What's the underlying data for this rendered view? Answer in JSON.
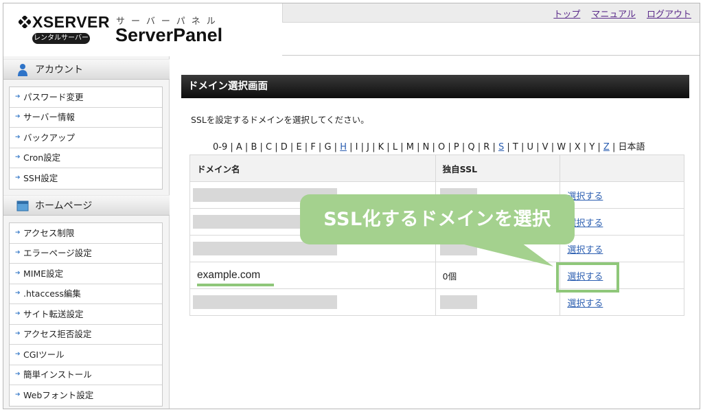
{
  "header": {
    "logo_text": "XSERVER",
    "logo_sub": "レンタルサーバー",
    "panel_kana": "サーバーパネル",
    "panel_title": "ServerPanel",
    "links": [
      "トップ",
      "マニュアル",
      "ログアウト"
    ]
  },
  "sidebar": {
    "account": {
      "title": "アカウント",
      "items": [
        "パスワード変更",
        "サーバー情報",
        "バックアップ",
        "Cron設定",
        "SSH設定"
      ]
    },
    "homepage": {
      "title": "ホームページ",
      "items": [
        "アクセス制限",
        "エラーページ設定",
        "MIME設定",
        ".htaccess編集",
        "サイト転送設定",
        "アクセス拒否設定",
        "CGIツール",
        "簡単インストール",
        "Webフォント設定"
      ]
    }
  },
  "main": {
    "title": "ドメイン選択画面",
    "instruction": "SSLを設定するドメインを選択してください。",
    "alpha_nav": [
      {
        "label": "0-9",
        "link": false
      },
      {
        "label": "A",
        "link": false
      },
      {
        "label": "B",
        "link": false
      },
      {
        "label": "C",
        "link": false
      },
      {
        "label": "D",
        "link": false
      },
      {
        "label": "E",
        "link": false
      },
      {
        "label": "F",
        "link": false
      },
      {
        "label": "G",
        "link": false
      },
      {
        "label": "H",
        "link": true
      },
      {
        "label": "I",
        "link": false
      },
      {
        "label": "J",
        "link": false
      },
      {
        "label": "K",
        "link": false
      },
      {
        "label": "L",
        "link": false
      },
      {
        "label": "M",
        "link": false
      },
      {
        "label": "N",
        "link": false
      },
      {
        "label": "O",
        "link": false
      },
      {
        "label": "P",
        "link": false
      },
      {
        "label": "Q",
        "link": false
      },
      {
        "label": "R",
        "link": false
      },
      {
        "label": "S",
        "link": true
      },
      {
        "label": "T",
        "link": false
      },
      {
        "label": "U",
        "link": false
      },
      {
        "label": "V",
        "link": false
      },
      {
        "label": "W",
        "link": false
      },
      {
        "label": "X",
        "link": false
      },
      {
        "label": "Y",
        "link": false
      },
      {
        "label": "Z",
        "link": true
      },
      {
        "label": "日本語",
        "link": false
      }
    ],
    "table": {
      "headers": [
        "ドメイン名",
        "独自SSL",
        ""
      ],
      "rows": [
        {
          "domain": "",
          "ssl": "",
          "action": "選択する",
          "masked": true
        },
        {
          "domain": "",
          "ssl": "",
          "action": "選択する",
          "masked": true
        },
        {
          "domain": "",
          "ssl": "",
          "action": "選択する",
          "masked": true
        },
        {
          "domain": "example.com",
          "ssl": "0個",
          "action": "選択する",
          "masked": false
        },
        {
          "domain": "",
          "ssl": "",
          "action": "選択する",
          "masked": true
        }
      ]
    }
  },
  "callout": {
    "text": "SSL化するドメインを選択"
  },
  "colors": {
    "accent_green": "#a4d18e",
    "highlight_green": "#8fc77a",
    "link_blue": "#2a5db0",
    "link_purple": "#5a2a8a"
  }
}
